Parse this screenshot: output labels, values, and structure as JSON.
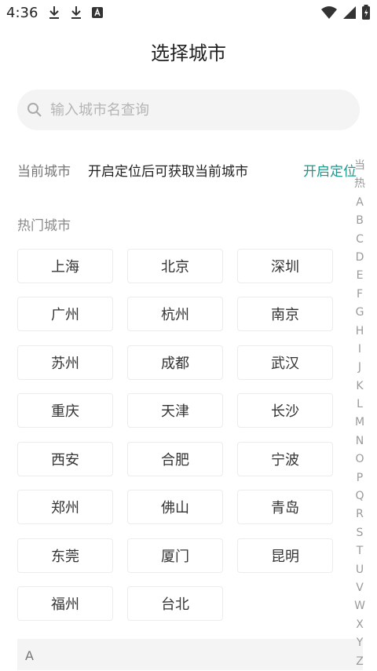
{
  "status": {
    "time": "4:36",
    "icons_left": [
      "download-icon",
      "download-icon",
      "a-badge-icon"
    ],
    "icons_right": [
      "wifi-icon",
      "signal-icon",
      "battery-icon"
    ]
  },
  "title": "选择城市",
  "search": {
    "placeholder": "输入城市名查询",
    "value": ""
  },
  "current": {
    "label": "当前城市",
    "text": "开启定位后可获取当前城市",
    "locate": "开启定位"
  },
  "hot": {
    "label": "热门城市",
    "cities": [
      "上海",
      "北京",
      "深圳",
      "广州",
      "杭州",
      "南京",
      "苏州",
      "成都",
      "武汉",
      "重庆",
      "天津",
      "长沙",
      "西安",
      "合肥",
      "宁波",
      "郑州",
      "佛山",
      "青岛",
      "东莞",
      "厦门",
      "昆明",
      "福州",
      "台北"
    ]
  },
  "index": [
    "当",
    "热",
    "A",
    "B",
    "C",
    "D",
    "E",
    "F",
    "G",
    "H",
    "I",
    "J",
    "K",
    "L",
    "M",
    "N",
    "O",
    "P",
    "Q",
    "R",
    "S",
    "T",
    "U",
    "V",
    "W",
    "X",
    "Y",
    "Z"
  ],
  "section": {
    "first": "A"
  },
  "colors": {
    "accent": "#1a9a8c",
    "muted": "#8a8a8a",
    "search_bg": "#f4f4f4"
  }
}
